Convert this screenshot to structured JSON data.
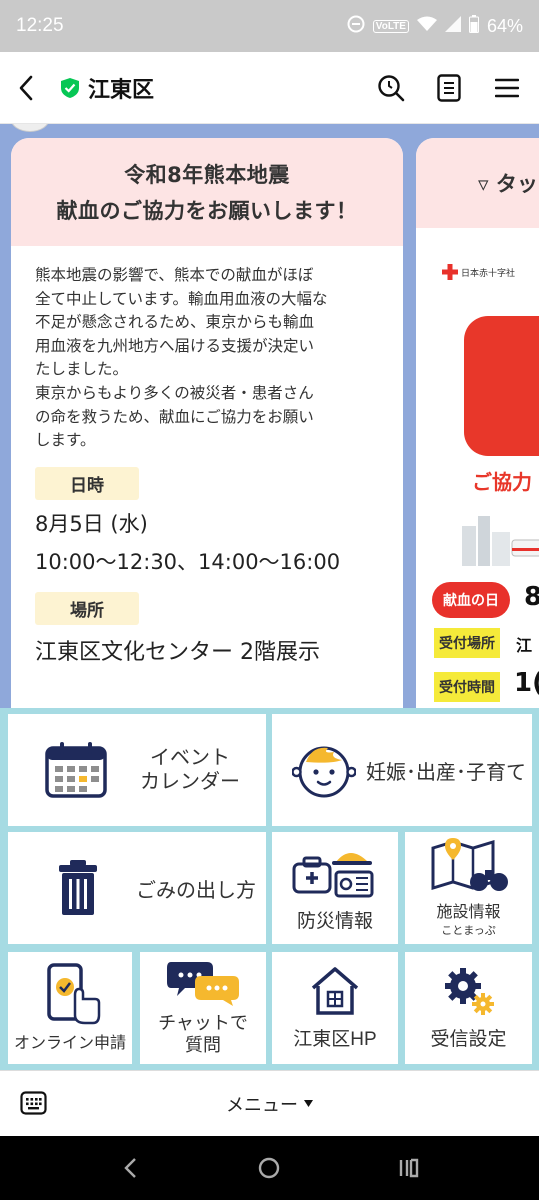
{
  "status_bar": {
    "time": "12:25",
    "volte": "VoLTE",
    "battery": "64%"
  },
  "header": {
    "title": "江東区"
  },
  "post": {
    "title_line1": "令和8年熊本地震",
    "title_line2": "献血のご協力をお願いします！",
    "description": "熊本地震の影響で、熊本での献血がほぼ\n全て中止しています。輸血用血液の大幅な\n不足が懸念されるため、東京からも輸血\n用血液を九州地方へ届ける支援が決定い\nたしました。\n東京からもより多くの被災者・患者さん\nの命を救うため、献血にご協力をお願い\nします。",
    "date_label": "日時",
    "date": "8月5日 (水)",
    "time": "10:00〜12:30、14:00〜16:00",
    "place_label": "場所",
    "place": "江東区文化センター 2階展示"
  },
  "post2": {
    "title_peek": "▿ タッ",
    "jrc_label": "日本赤十字社",
    "poster_sub": "ご協力",
    "blood_day": "献血の日",
    "blood_day_value": "8",
    "reception_place": "受付場所",
    "reception_place_value": "江",
    "reception_time": "受付時間",
    "reception_time_value": "1("
  },
  "rich_menu": {
    "event_calendar_line1": "イベント",
    "event_calendar_line2": "カレンダー",
    "childcare": "妊娠･出産･子育て",
    "garbage": "ごみの出し方",
    "disaster": "防災情報",
    "facility": "施設情報",
    "facility_sub": "ことまっぷ",
    "online": "オンライン申請",
    "chat_line1": "チャットで",
    "chat_line2": "質問",
    "hp": "江東区HP",
    "settings": "受信設定"
  },
  "menubar": {
    "label": "メニュー"
  },
  "colors": {
    "accent_green": "#06c755",
    "menu_bg": "#a6dbe3",
    "chat_bg": "#8fa8da",
    "header_pink": "#fde4e4",
    "tag_yellow": "#fdf3d2",
    "red": "#e8312b"
  }
}
